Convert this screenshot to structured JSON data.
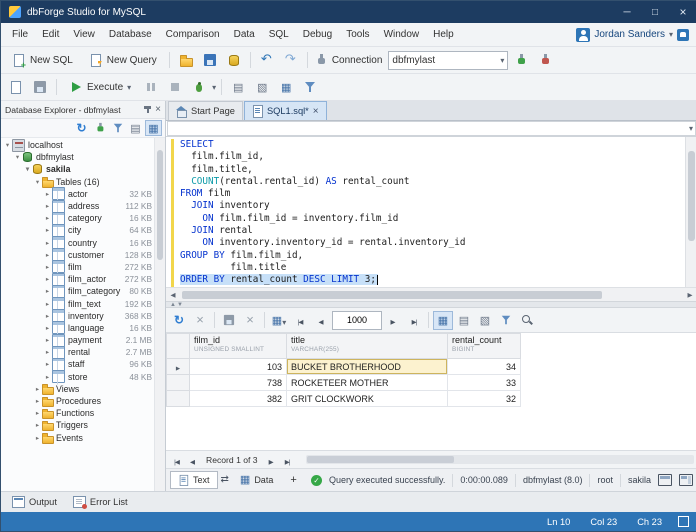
{
  "window": {
    "title": "dbForge Studio for MySQL"
  },
  "menubar": {
    "items": [
      "File",
      "Edit",
      "View",
      "Database",
      "Comparison",
      "Data",
      "SQL",
      "Debug",
      "Tools",
      "Window",
      "Help"
    ],
    "user_name": "Jordan Sanders"
  },
  "toolbar_main": {
    "new_sql_label": "New SQL",
    "new_query_label": "New Query",
    "connection_label": "Connection",
    "connection_value": "dbfmylast"
  },
  "toolbar_sql": {
    "execute_label": "Execute"
  },
  "explorer": {
    "title": "Database Explorer - dbfmylast",
    "tree": [
      {
        "label": "localhost",
        "level": 0,
        "icon": "server",
        "exp": "open"
      },
      {
        "label": "dbfmylast",
        "level": 1,
        "icon": "db-green",
        "exp": "open"
      },
      {
        "label": "sakila",
        "level": 2,
        "icon": "db-yellow",
        "exp": "open",
        "bold": true
      },
      {
        "label": "Tables (16)",
        "level": 3,
        "icon": "folder",
        "exp": "open"
      },
      {
        "label": "actor",
        "size": "32 KB",
        "level": 4,
        "icon": "table",
        "exp": "closed"
      },
      {
        "label": "address",
        "size": "112 KB",
        "level": 4,
        "icon": "table",
        "exp": "closed"
      },
      {
        "label": "category",
        "size": "16 KB",
        "level": 4,
        "icon": "table",
        "exp": "closed"
      },
      {
        "label": "city",
        "size": "64 KB",
        "level": 4,
        "icon": "table",
        "exp": "closed"
      },
      {
        "label": "country",
        "size": "16 KB",
        "level": 4,
        "icon": "table",
        "exp": "closed"
      },
      {
        "label": "customer",
        "size": "128 KB",
        "level": 4,
        "icon": "table",
        "exp": "closed"
      },
      {
        "label": "film",
        "size": "272 KB",
        "level": 4,
        "icon": "table",
        "exp": "closed"
      },
      {
        "label": "film_actor",
        "size": "272 KB",
        "level": 4,
        "icon": "table",
        "exp": "closed"
      },
      {
        "label": "film_category",
        "size": "80 KB",
        "level": 4,
        "icon": "table",
        "exp": "closed"
      },
      {
        "label": "film_text",
        "size": "192 KB",
        "level": 4,
        "icon": "table",
        "exp": "closed"
      },
      {
        "label": "inventory",
        "size": "368 KB",
        "level": 4,
        "icon": "table",
        "exp": "closed"
      },
      {
        "label": "language",
        "size": "16 KB",
        "level": 4,
        "icon": "table",
        "exp": "closed"
      },
      {
        "label": "payment",
        "size": "2.1 MB",
        "level": 4,
        "icon": "table",
        "exp": "closed"
      },
      {
        "label": "rental",
        "size": "2.7 MB",
        "level": 4,
        "icon": "table",
        "exp": "closed"
      },
      {
        "label": "staff",
        "size": "96 KB",
        "level": 4,
        "icon": "table",
        "exp": "closed"
      },
      {
        "label": "store",
        "size": "48 KB",
        "level": 4,
        "icon": "table",
        "exp": "closed"
      },
      {
        "label": "Views",
        "level": 3,
        "icon": "folder",
        "exp": "closed"
      },
      {
        "label": "Procedures",
        "level": 3,
        "icon": "folder",
        "exp": "closed"
      },
      {
        "label": "Functions",
        "level": 3,
        "icon": "folder",
        "exp": "closed"
      },
      {
        "label": "Triggers",
        "level": 3,
        "icon": "folder",
        "exp": "closed"
      },
      {
        "label": "Events",
        "level": 3,
        "icon": "folder",
        "exp": "closed"
      }
    ]
  },
  "doc_tabs": [
    {
      "label": "Start Page",
      "active": false
    },
    {
      "label": "SQL1.sql*",
      "active": true
    }
  ],
  "editor": {
    "lines": [
      {
        "tokens": [
          {
            "t": "kw",
            "s": "SELECT"
          }
        ]
      },
      {
        "tokens": [
          {
            "t": "pl",
            "s": "  film.film_id,"
          }
        ]
      },
      {
        "tokens": [
          {
            "t": "pl",
            "s": "  film.title,"
          }
        ]
      },
      {
        "tokens": [
          {
            "t": "pl",
            "s": "  "
          },
          {
            "t": "fn",
            "s": "COUNT"
          },
          {
            "t": "pl",
            "s": "(rental.rental_id) "
          },
          {
            "t": "kw",
            "s": "AS"
          },
          {
            "t": "pl",
            "s": " rental_count"
          }
        ]
      },
      {
        "tokens": [
          {
            "t": "kw",
            "s": "FROM"
          },
          {
            "t": "pl",
            "s": " film"
          }
        ]
      },
      {
        "tokens": [
          {
            "t": "pl",
            "s": "  "
          },
          {
            "t": "kw",
            "s": "JOIN"
          },
          {
            "t": "pl",
            "s": " inventory"
          }
        ]
      },
      {
        "tokens": [
          {
            "t": "pl",
            "s": "    "
          },
          {
            "t": "kw",
            "s": "ON"
          },
          {
            "t": "pl",
            "s": " film.film_id = inventory.film_id"
          }
        ]
      },
      {
        "tokens": [
          {
            "t": "pl",
            "s": "  "
          },
          {
            "t": "kw",
            "s": "JOIN"
          },
          {
            "t": "pl",
            "s": " rental"
          }
        ]
      },
      {
        "tokens": [
          {
            "t": "pl",
            "s": "    "
          },
          {
            "t": "kw",
            "s": "ON"
          },
          {
            "t": "pl",
            "s": " inventory.inventory_id = rental.inventory_id"
          }
        ]
      },
      {
        "tokens": [
          {
            "t": "kw",
            "s": "GROUP BY"
          },
          {
            "t": "pl",
            "s": " film.film_id,"
          }
        ]
      },
      {
        "tokens": [
          {
            "t": "pl",
            "s": "         film.title"
          }
        ]
      },
      {
        "tokens": [
          {
            "t": "kw",
            "s": "ORDER BY"
          },
          {
            "t": "pl",
            "s": " rental_count "
          },
          {
            "t": "kw",
            "s": "DESC"
          },
          {
            "t": "pl",
            "s": " "
          },
          {
            "t": "kw",
            "s": "LIMIT"
          },
          {
            "t": "pl",
            "s": " 3;"
          }
        ],
        "selected": true
      }
    ]
  },
  "results": {
    "page_size": "1000",
    "columns": [
      {
        "name": "film_id",
        "type": "UNSIGNED SMALLINT",
        "align": "right"
      },
      {
        "name": "title",
        "type": "VARCHAR(255)",
        "align": "left"
      },
      {
        "name": "rental_count",
        "type": "BIGINT",
        "align": "right"
      }
    ],
    "rows": [
      {
        "cells": [
          "103",
          "BUCKET BROTHERHOOD",
          "34"
        ]
      },
      {
        "cells": [
          "738",
          "ROCKETEER MOTHER",
          "33"
        ]
      },
      {
        "cells": [
          "382",
          "GRIT CLOCKWORK",
          "32"
        ]
      }
    ],
    "current_cell": {
      "row": 0,
      "col": 1
    },
    "record_status": "Record 1 of 3",
    "view_tabs": [
      {
        "label": "Text",
        "active": true
      },
      {
        "label": "Data",
        "active": false
      }
    ],
    "add_tab_label": "+"
  },
  "statusbar": {
    "message": "Query executed successfully.",
    "duration": "0:00:00.089",
    "connection": "dbfmylast (8.0)",
    "user": "root",
    "database": "sakila"
  },
  "bottom_panel": {
    "tabs": [
      {
        "label": "Output"
      },
      {
        "label": "Error List"
      }
    ]
  },
  "app_status": {
    "ln": "Ln 10",
    "col": "Col 23",
    "ch": "Ch 23"
  }
}
